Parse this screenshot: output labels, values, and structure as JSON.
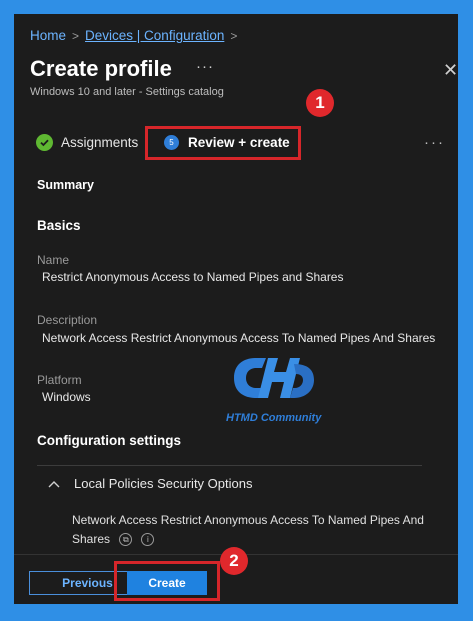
{
  "breadcrumb": {
    "home": "Home",
    "sep1": ">",
    "devices": "Devices | Configuration",
    "sep2": ">"
  },
  "header": {
    "title": "Create profile",
    "more": "···",
    "subtitle": "Windows 10 and later - Settings catalog",
    "close": "✕"
  },
  "callouts": {
    "one": "1",
    "two": "2"
  },
  "tabs": {
    "assignments": "Assignments",
    "review_step_number": "5",
    "review": "Review + create",
    "more": "···"
  },
  "summary": {
    "heading": "Summary",
    "basics_heading": "Basics",
    "name_label": "Name",
    "name_value": "Restrict Anonymous Access to Named Pipes and Shares",
    "description_label": "Description",
    "description_value": "Network Access Restrict Anonymous Access To Named Pipes And Shares",
    "platform_label": "Platform",
    "platform_value": "Windows",
    "config_heading": "Configuration settings"
  },
  "watermark": {
    "text": "HTMD Community"
  },
  "settings_group": {
    "label": "Local Policies Security Options",
    "setting_text": "Network Access Restrict Anonymous Access To Named Pipes And Shares"
  },
  "footer": {
    "previous": "Previous",
    "create": "Create"
  },
  "colors": {
    "accent": "#2f8fe6",
    "highlight": "#d6262a",
    "check": "#5fb832"
  }
}
